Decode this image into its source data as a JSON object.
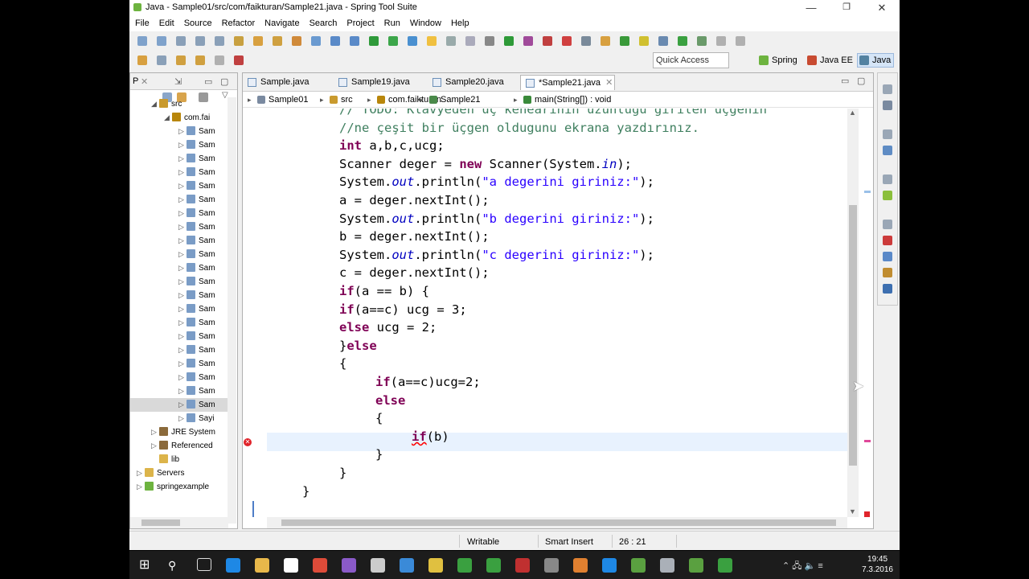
{
  "window": {
    "title": "Java - Sample01/src/com/faikturan/Sample21.java - Spring Tool Suite",
    "min": "—",
    "max": "❐",
    "close": "✕"
  },
  "menu": [
    "File",
    "Edit",
    "Source",
    "Refactor",
    "Navigate",
    "Search",
    "Project",
    "Run",
    "Window",
    "Help"
  ],
  "toolbar": {
    "quick_access": "Quick Access",
    "perspectives": [
      "Spring",
      "Java EE",
      "Java"
    ],
    "perspective_colors": [
      "#6db33f",
      "#c84b31",
      "#5382a1"
    ]
  },
  "left_pane": {
    "tab_label": "P",
    "rows": [
      {
        "label": "src",
        "icon": "package-folder-icon",
        "color": "#c99a2e",
        "arrow": "◢",
        "indent": 0
      },
      {
        "label": "com.fai",
        "icon": "package-icon",
        "color": "#b8860b",
        "arrow": "◢",
        "indent": 1
      },
      {
        "label": "Sam",
        "icon": "java-file-icon",
        "color": "#7a9cc6",
        "arrow": "▷",
        "indent": 2
      },
      {
        "label": "Sam",
        "icon": "java-file-icon",
        "color": "#7a9cc6",
        "arrow": "▷",
        "indent": 2
      },
      {
        "label": "Sam",
        "icon": "java-file-icon",
        "color": "#7a9cc6",
        "arrow": "▷",
        "indent": 2
      },
      {
        "label": "Sam",
        "icon": "java-file-icon",
        "color": "#7a9cc6",
        "arrow": "▷",
        "indent": 2
      },
      {
        "label": "Sam",
        "icon": "java-file-icon",
        "color": "#7a9cc6",
        "arrow": "▷",
        "indent": 2
      },
      {
        "label": "Sam",
        "icon": "java-file-icon",
        "color": "#7a9cc6",
        "arrow": "▷",
        "indent": 2
      },
      {
        "label": "Sam",
        "icon": "java-file-icon",
        "color": "#7a9cc6",
        "arrow": "▷",
        "indent": 2
      },
      {
        "label": "Sam",
        "icon": "java-file-icon",
        "color": "#7a9cc6",
        "arrow": "▷",
        "indent": 2
      },
      {
        "label": "Sam",
        "icon": "java-file-icon",
        "color": "#7a9cc6",
        "arrow": "▷",
        "indent": 2
      },
      {
        "label": "Sam",
        "icon": "java-file-icon",
        "color": "#7a9cc6",
        "arrow": "▷",
        "indent": 2
      },
      {
        "label": "Sam",
        "icon": "java-file-icon",
        "color": "#7a9cc6",
        "arrow": "▷",
        "indent": 2
      },
      {
        "label": "Sam",
        "icon": "java-file-icon",
        "color": "#7a9cc6",
        "arrow": "▷",
        "indent": 2
      },
      {
        "label": "Sam",
        "icon": "java-file-icon",
        "color": "#7a9cc6",
        "arrow": "▷",
        "indent": 2
      },
      {
        "label": "Sam",
        "icon": "java-file-icon",
        "color": "#7a9cc6",
        "arrow": "▷",
        "indent": 2
      },
      {
        "label": "Sam",
        "icon": "java-file-icon",
        "color": "#7a9cc6",
        "arrow": "▷",
        "indent": 2
      },
      {
        "label": "Sam",
        "icon": "java-file-icon",
        "color": "#7a9cc6",
        "arrow": "▷",
        "indent": 2
      },
      {
        "label": "Sam",
        "icon": "java-file-icon",
        "color": "#7a9cc6",
        "arrow": "▷",
        "indent": 2
      },
      {
        "label": "Sam",
        "icon": "java-file-icon",
        "color": "#7a9cc6",
        "arrow": "▷",
        "indent": 2
      },
      {
        "label": "Sam",
        "icon": "java-file-icon",
        "color": "#7a9cc6",
        "arrow": "▷",
        "indent": 2
      },
      {
        "label": "Sam",
        "icon": "java-file-icon",
        "color": "#7a9cc6",
        "arrow": "▷",
        "indent": 2
      },
      {
        "label": "Sam",
        "icon": "java-file-icon",
        "color": "#7a9cc6",
        "arrow": "▷",
        "indent": 2,
        "selected": true
      },
      {
        "label": "Sayi",
        "icon": "java-file-icon",
        "color": "#7a9cc6",
        "arrow": "▷",
        "indent": 2
      },
      {
        "label": "JRE System",
        "icon": "library-icon",
        "color": "#8b6a3b",
        "arrow": "▷",
        "indent": 0
      },
      {
        "label": "Referenced",
        "icon": "library-icon",
        "color": "#8b6a3b",
        "arrow": "▷",
        "indent": 0
      },
      {
        "label": "lib",
        "icon": "folder-icon",
        "color": "#dcb44a",
        "arrow": "",
        "indent": 0
      },
      {
        "label": "Servers",
        "icon": "folder-icon",
        "color": "#dcb44a",
        "arrow": "▷",
        "indent": -1
      },
      {
        "label": "springexample",
        "icon": "project-icon",
        "color": "#6db33f",
        "arrow": "▷",
        "indent": -1
      }
    ]
  },
  "editor": {
    "tabs": [
      "Sample.java",
      "Sample19.java",
      "Sample20.java",
      "*Sample21.java"
    ],
    "active_tab": 3,
    "breadcrumb": [
      "Sample01",
      "src",
      "com.faikturan",
      "Sample21",
      "main(String[]) : void"
    ],
    "code_lines": [
      {
        "indent": 0,
        "parts": [
          [
            "cm",
            "// TODO: Klavyeden üç kenearının uzunluğu girilen üçgenin"
          ]
        ]
      },
      {
        "indent": 0,
        "parts": [
          [
            "cm",
            "//ne çeşit bir üçgen oldugunu ekrana yazdırınız."
          ]
        ]
      },
      {
        "indent": 0,
        "parts": [
          [
            "kw",
            "int"
          ],
          [
            "",
            "a,b,c,ucg;"
          ]
        ]
      },
      {
        "indent": 0,
        "parts": [
          [
            "",
            "Scanner deger = "
          ],
          [
            "kw",
            "new"
          ],
          [
            "",
            "Scanner(System."
          ],
          [
            "fi",
            "in"
          ],
          [
            "",
            ");"
          ]
        ]
      },
      {
        "indent": 0,
        "parts": [
          [
            "",
            "System."
          ],
          [
            "fi",
            "out"
          ],
          [
            "",
            ".println("
          ],
          [
            "st",
            "\"a degerini giriniz:\""
          ],
          [
            "",
            ");"
          ]
        ]
      },
      {
        "indent": 0,
        "parts": [
          [
            "",
            "a = deger.nextInt();"
          ]
        ]
      },
      {
        "indent": 0,
        "parts": [
          [
            "",
            "System."
          ],
          [
            "fi",
            "out"
          ],
          [
            "",
            ".println("
          ],
          [
            "st",
            "\"b degerini giriniz:\""
          ],
          [
            "",
            ");"
          ]
        ]
      },
      {
        "indent": 0,
        "parts": [
          [
            "",
            "b = deger.nextInt();"
          ]
        ]
      },
      {
        "indent": 0,
        "parts": [
          [
            "",
            "System."
          ],
          [
            "fi",
            "out"
          ],
          [
            "",
            ".println("
          ],
          [
            "st",
            "\"c degerini giriniz:\""
          ],
          [
            "",
            ");"
          ]
        ]
      },
      {
        "indent": 0,
        "parts": [
          [
            "",
            "c = deger.nextInt();"
          ]
        ]
      },
      {
        "indent": 0,
        "parts": [
          [
            "kw",
            "if"
          ],
          [
            "",
            "(a == b) {"
          ]
        ]
      },
      {
        "indent": 0,
        "parts": [
          [
            "kw",
            "if"
          ],
          [
            "",
            "(a==c) ucg = 3;"
          ]
        ]
      },
      {
        "indent": 0,
        "parts": [
          [
            "kw",
            "else"
          ],
          [
            "",
            "ucg = 2;"
          ]
        ]
      },
      {
        "indent": 0,
        "parts": [
          [
            "",
            "}"
          ],
          [
            "kw",
            "else"
          ]
        ]
      },
      {
        "indent": 0,
        "parts": [
          [
            "",
            "{"
          ]
        ]
      },
      {
        "indent": 1,
        "parts": [
          [
            "kw",
            "if"
          ],
          [
            "",
            "(a==c)ucg=2;"
          ]
        ]
      },
      {
        "indent": 1,
        "parts": [
          [
            "kw",
            "else"
          ]
        ]
      },
      {
        "indent": 1,
        "parts": [
          [
            "",
            "{"
          ]
        ]
      },
      {
        "indent": 2,
        "parts": [
          [
            "kw err",
            "if"
          ],
          [
            "",
            "(b)"
          ]
        ]
      },
      {
        "indent": 1,
        "parts": [
          [
            "",
            "}"
          ]
        ]
      },
      {
        "indent": 0,
        "parts": [
          [
            "",
            "}"
          ]
        ]
      },
      {
        "indent": -1,
        "parts": [
          [
            "",
            "}"
          ]
        ]
      }
    ]
  },
  "status": {
    "writable": "Writable",
    "insert_mode": "Smart Insert",
    "position": "26 : 21"
  },
  "taskbar": {
    "time": "19:45",
    "date": "7.3.2016",
    "tray": "⌃ 🖧 🔈 ≡"
  }
}
